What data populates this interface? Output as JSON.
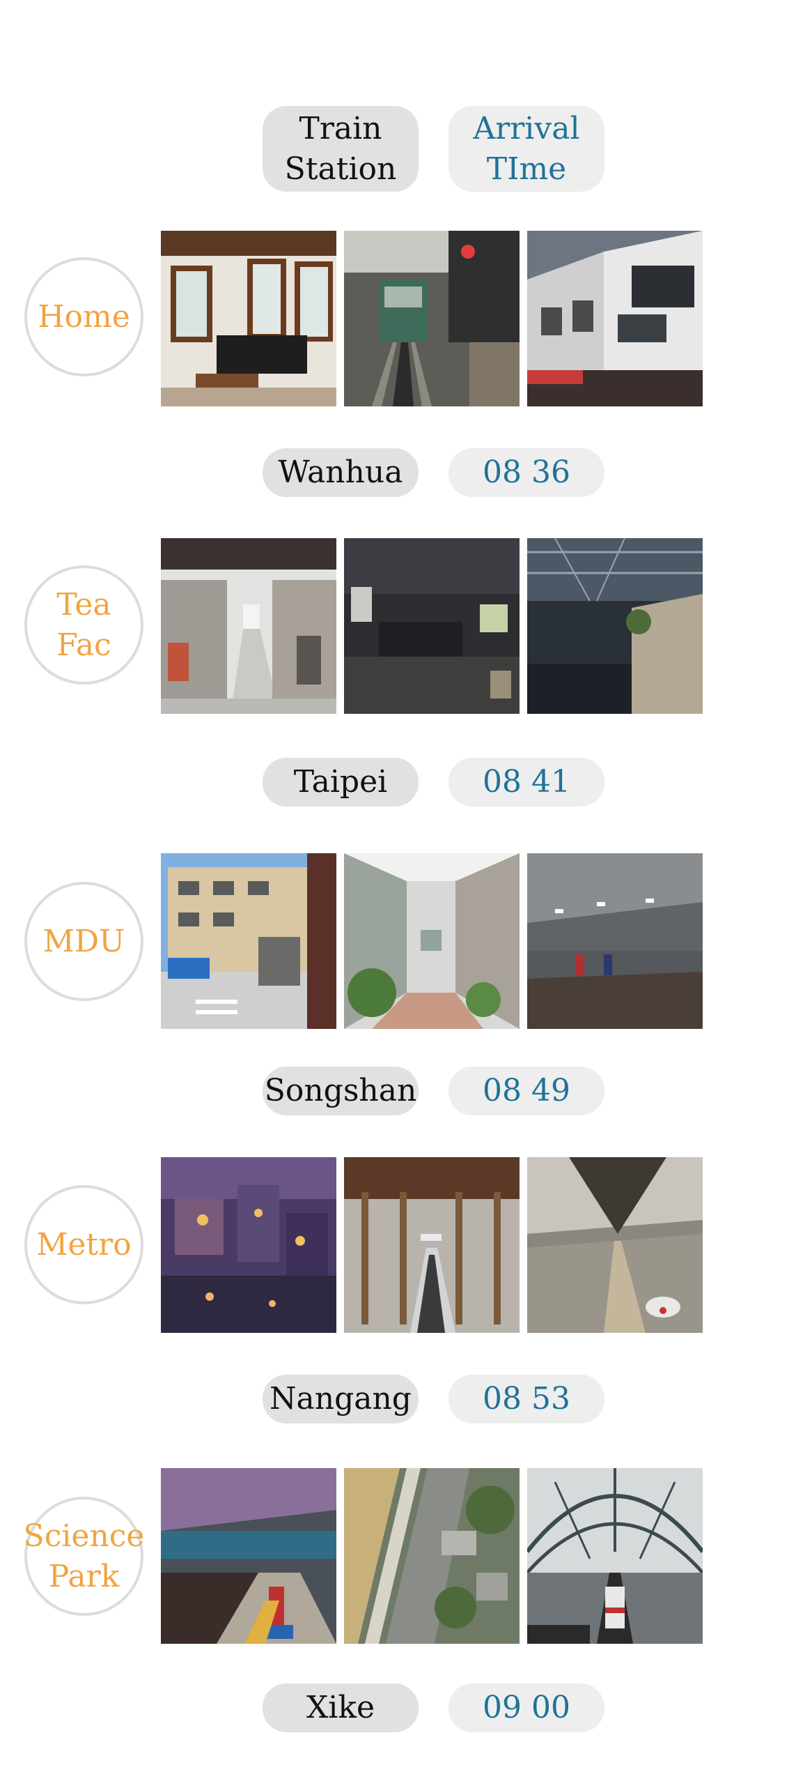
{
  "header": {
    "station_label": "Train\nStation",
    "time_label": "Arrival\nTIme"
  },
  "colors": {
    "destination_text": "#f0a442",
    "time_text": "#1f7396",
    "station_pill": "#e3e0e0",
    "time_pill": "#eeeeee",
    "circle_border": "#dcdcdc"
  },
  "rows": [
    {
      "destination": "Home",
      "photos": [
        "living-room-photo",
        "tram-street-photo",
        "townhouse-photo"
      ],
      "station": "Wanhua",
      "time": "08 36"
    },
    {
      "destination": "Tea\nFac",
      "photos": [
        "market-hall-photo",
        "dark-factory-photo",
        "steel-roof-hall-photo"
      ],
      "station": "Taipei",
      "time": "08 41"
    },
    {
      "destination": "MDU",
      "photos": [
        "city-street-photo",
        "alley-photo",
        "station-platform-photo"
      ],
      "station": "Songshan",
      "time": "08 49"
    },
    {
      "destination": "Metro",
      "photos": [
        "fantasy-city-photo",
        "train-hall-photo",
        "futuristic-station-photo"
      ],
      "station": "Nangang",
      "time": "08 53"
    },
    {
      "destination": "Science\nPark",
      "photos": [
        "curved-platform-photo",
        "aerial-rail-photo",
        "glass-dome-station-photo"
      ],
      "station": "Xike",
      "time": "09 00"
    }
  ]
}
